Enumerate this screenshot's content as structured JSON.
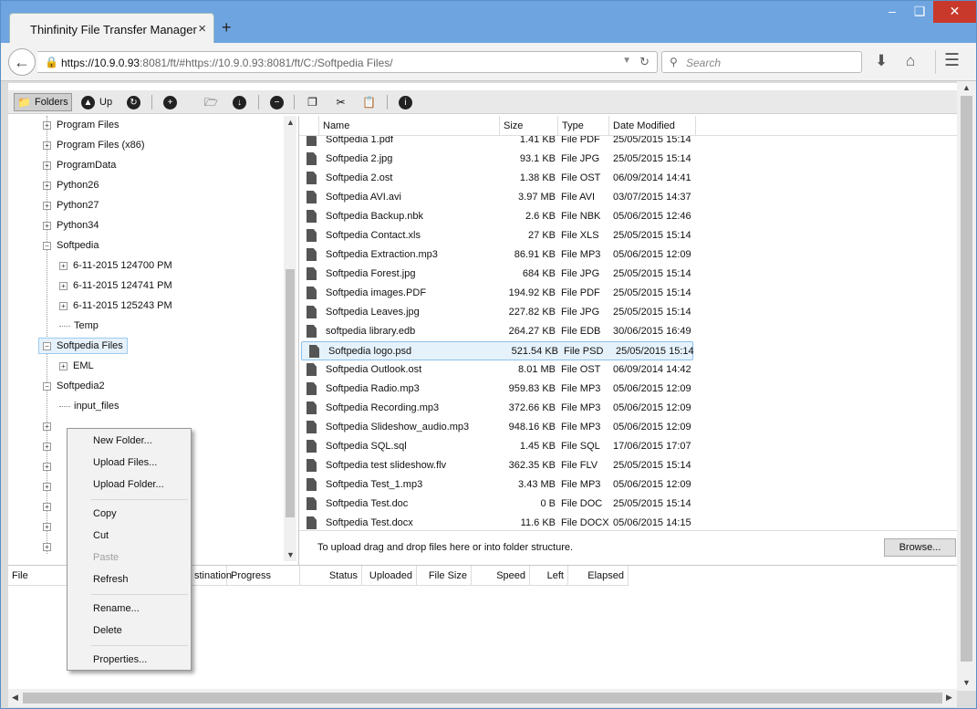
{
  "browser": {
    "tab_title": "Thinfinity File Transfer Manager",
    "tab_close": "×",
    "new_tab": "+",
    "url_host": "https://10.9.0.93",
    "url_rest": ":8081/ft/#https://10.9.0.93:8081/ft/C:/Softpedia Files/",
    "search_placeholder": "Search"
  },
  "toolbar": {
    "folders_label": "Folders",
    "up_label": "Up"
  },
  "tree": [
    {
      "label": "Program Files",
      "level": 0,
      "expander": "+"
    },
    {
      "label": "Program Files (x86)",
      "level": 0,
      "expander": "+"
    },
    {
      "label": "ProgramData",
      "level": 0,
      "expander": "+"
    },
    {
      "label": "Python26",
      "level": 0,
      "expander": "+"
    },
    {
      "label": "Python27",
      "level": 0,
      "expander": "+"
    },
    {
      "label": "Python34",
      "level": 0,
      "expander": "+"
    },
    {
      "label": "Softpedia",
      "level": 0,
      "expander": "−"
    },
    {
      "label": "6-11-2015 124700 PM",
      "level": 1,
      "expander": "+"
    },
    {
      "label": "6-11-2015 124741 PM",
      "level": 1,
      "expander": "+"
    },
    {
      "label": "6-11-2015 125243 PM",
      "level": 1,
      "expander": "+"
    },
    {
      "label": "Temp",
      "level": 1,
      "expander": ""
    },
    {
      "label": "Softpedia Files",
      "level": 0,
      "expander": "−",
      "selected": true
    },
    {
      "label": "EML",
      "level": 1,
      "expander": "+"
    },
    {
      "label": "Softpedia2",
      "level": 0,
      "expander": "−"
    },
    {
      "label": "input_files",
      "level": 1,
      "expander": ""
    },
    {
      "label": "",
      "level": 0,
      "expander": "+"
    },
    {
      "label": "",
      "level": 0,
      "expander": "+"
    },
    {
      "label": "",
      "level": 0,
      "expander": "+"
    },
    {
      "label": "",
      "level": 0,
      "expander": "+"
    },
    {
      "label": "",
      "level": 0,
      "expander": "+"
    },
    {
      "label": "",
      "level": 0,
      "expander": "+"
    },
    {
      "label": "",
      "level": 0,
      "expander": "+"
    }
  ],
  "files": {
    "headers": {
      "name": "Name",
      "size": "Size",
      "type": "Type",
      "date": "Date Modified"
    },
    "rows": [
      {
        "name": "Softpedia 1.pdf",
        "size": "1.41 KB",
        "type": "File PDF",
        "date": "25/05/2015 15:14"
      },
      {
        "name": "Softpedia 2.jpg",
        "size": "93.1 KB",
        "type": "File JPG",
        "date": "25/05/2015 15:14"
      },
      {
        "name": "Softpedia 2.ost",
        "size": "1.38 KB",
        "type": "File OST",
        "date": "06/09/2014 14:41"
      },
      {
        "name": "Softpedia AVI.avi",
        "size": "3.97 MB",
        "type": "File AVI",
        "date": "03/07/2015 14:37"
      },
      {
        "name": "Softpedia Backup.nbk",
        "size": "2.6 KB",
        "type": "File NBK",
        "date": "05/06/2015 12:46"
      },
      {
        "name": "Softpedia Contact.xls",
        "size": "27 KB",
        "type": "File XLS",
        "date": "25/05/2015 15:14"
      },
      {
        "name": "Softpedia Extraction.mp3",
        "size": "86.91 KB",
        "type": "File MP3",
        "date": "05/06/2015 12:09"
      },
      {
        "name": "Softpedia Forest.jpg",
        "size": "684 KB",
        "type": "File JPG",
        "date": "25/05/2015 15:14"
      },
      {
        "name": "Softpedia images.PDF",
        "size": "194.92 KB",
        "type": "File PDF",
        "date": "25/05/2015 15:14"
      },
      {
        "name": "Softpedia Leaves.jpg",
        "size": "227.82 KB",
        "type": "File JPG",
        "date": "25/05/2015 15:14"
      },
      {
        "name": "softpedia library.edb",
        "size": "264.27 KB",
        "type": "File EDB",
        "date": "30/06/2015 16:49"
      },
      {
        "name": "Softpedia logo.psd",
        "size": "521.54 KB",
        "type": "File PSD",
        "date": "25/05/2015 15:14",
        "selected": true
      },
      {
        "name": "Softpedia Outlook.ost",
        "size": "8.01 MB",
        "type": "File OST",
        "date": "06/09/2014 14:42"
      },
      {
        "name": "Softpedia Radio.mp3",
        "size": "959.83 KB",
        "type": "File MP3",
        "date": "05/06/2015 12:09"
      },
      {
        "name": "Softpedia Recording.mp3",
        "size": "372.66 KB",
        "type": "File MP3",
        "date": "05/06/2015 12:09"
      },
      {
        "name": "Softpedia Slideshow_audio.mp3",
        "size": "948.16 KB",
        "type": "File MP3",
        "date": "05/06/2015 12:09"
      },
      {
        "name": "Softpedia SQL.sql",
        "size": "1.45 KB",
        "type": "File SQL",
        "date": "17/06/2015 17:07"
      },
      {
        "name": "Softpedia test slideshow.flv",
        "size": "362.35 KB",
        "type": "File FLV",
        "date": "25/05/2015 15:14"
      },
      {
        "name": "Softpedia Test_1.mp3",
        "size": "3.43 MB",
        "type": "File MP3",
        "date": "05/06/2015 12:09"
      },
      {
        "name": "Softpedia Test.doc",
        "size": "0 B",
        "type": "File DOC",
        "date": "25/05/2015 15:14"
      },
      {
        "name": "Softpedia Test.docx",
        "size": "11.6 KB",
        "type": "File DOCX",
        "date": "05/06/2015 14:15"
      }
    ],
    "drop_text": "To upload drag and drop files here or into folder structure.",
    "browse_label": "Browse..."
  },
  "transfer": {
    "headers": [
      "File",
      "stination",
      "Progress",
      "Status",
      "Uploaded",
      "File Size",
      "Speed",
      "Left",
      "Elapsed"
    ]
  },
  "context_menu": [
    {
      "label": "New Folder...",
      "enabled": true
    },
    {
      "label": "Upload Files...",
      "enabled": true
    },
    {
      "label": "Upload Folder...",
      "enabled": true
    },
    {
      "label": "Copy",
      "enabled": true
    },
    {
      "label": "Cut",
      "enabled": true
    },
    {
      "label": "Paste",
      "enabled": false
    },
    {
      "label": "Refresh",
      "enabled": true
    },
    {
      "label": "Rename...",
      "enabled": true
    },
    {
      "label": "Delete",
      "enabled": true
    },
    {
      "label": "Properties...",
      "enabled": true
    }
  ],
  "colors": {
    "titlebar": "#6ea5e0",
    "selection_bg": "#e6f2fb",
    "selection_border": "#8cc0ec",
    "close_button": "#c9392b"
  }
}
